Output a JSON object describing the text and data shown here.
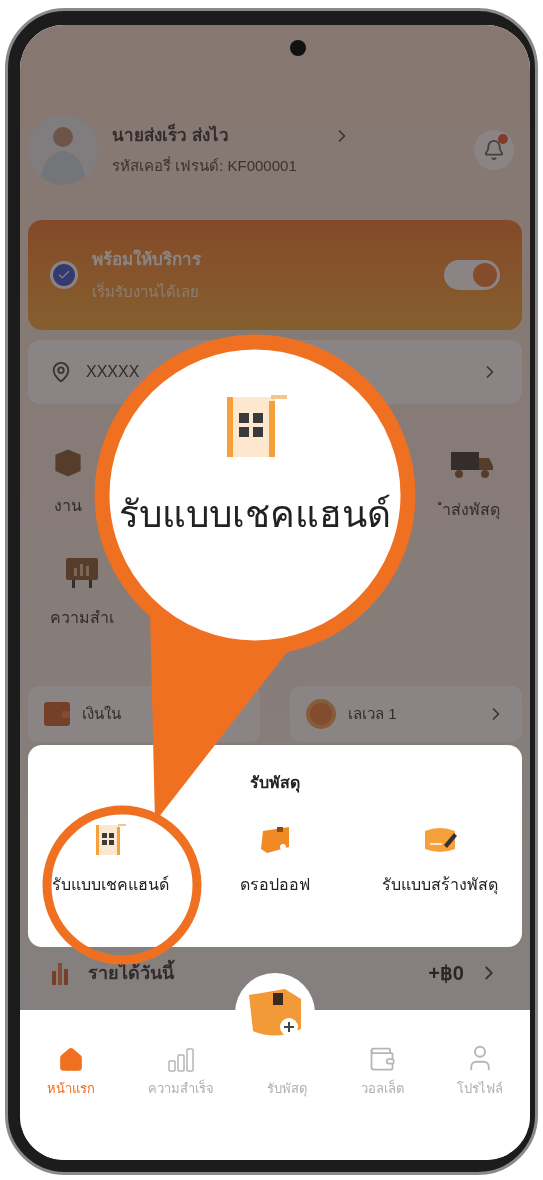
{
  "profile": {
    "name": "นายส่งเร็ว ส่งไว",
    "code": "รหัสเคอรี่ เฟรนด์: KF000001",
    "has_notification": true
  },
  "status": {
    "title": "พร้อมให้บริการ",
    "subtitle": "เริ่มรับงานได้เลย",
    "on": true
  },
  "location": {
    "text": "XXXXX"
  },
  "menu": [
    {
      "label": "งาน",
      "kind": "box"
    },
    {
      "label": "ำส่งพัสดุ",
      "kind": "truck"
    },
    {
      "label": "ความสำเ",
      "kind": "board"
    }
  ],
  "wallet": {
    "label": "เงินใน"
  },
  "level": {
    "label": "เลเวล 1"
  },
  "income": {
    "label": "รายได้วันนี้",
    "amount": "+฿0"
  },
  "sheet": {
    "title": "รับพัสดุ",
    "options": [
      {
        "label": "รับแบบเชคแฮนด์",
        "kind": "handshake"
      },
      {
        "label": "ดรอปออฟ",
        "kind": "dropoff"
      },
      {
        "label": "รับแบบสร้างพัสดุ",
        "kind": "create"
      }
    ]
  },
  "callout": {
    "label": "รับแบบเชคแฮนด์"
  },
  "nav": [
    {
      "label": "หน้าแรก",
      "kind": "home",
      "selected": true
    },
    {
      "label": "ความสำเร็จ",
      "kind": "stats",
      "selected": false
    },
    {
      "label": "รับพัสดุ",
      "kind": "parcel",
      "selected": false
    },
    {
      "label": "วอลเล็ต",
      "kind": "wallet",
      "selected": false
    },
    {
      "label": "โปรไฟล์",
      "kind": "profile",
      "selected": false
    }
  ]
}
